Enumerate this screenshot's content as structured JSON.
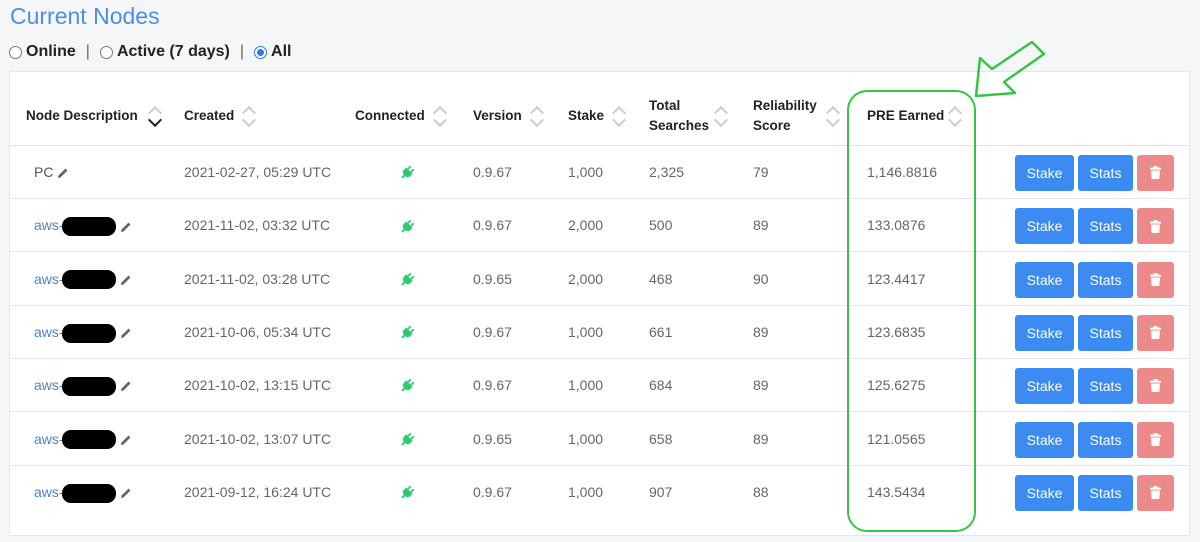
{
  "page": {
    "title": "Current Nodes"
  },
  "filters": [
    {
      "label": "Online",
      "checked": false
    },
    {
      "label": "Active (7 days)",
      "checked": false
    },
    {
      "label": "All",
      "checked": true
    }
  ],
  "filter_separator": "|",
  "table": {
    "headers": {
      "node_description": "Node Description",
      "created": "Created",
      "connected": "Connected",
      "version": "Version",
      "stake": "Stake",
      "total_searches_1": "Total",
      "total_searches_2": "Searches",
      "reliability_1": "Reliability",
      "reliability_2": "Score",
      "pre_earned": "PRE Earned"
    },
    "sort": {
      "column": "Node Description",
      "direction": "desc"
    },
    "rows": [
      {
        "name": "PC",
        "redacted": false,
        "created": "2021-02-27, 05:29 UTC",
        "version": "0.9.67",
        "stake": "1,000",
        "searches": "2,325",
        "reliability": "79",
        "pre_earned": "1,146.8816"
      },
      {
        "name": "aws-",
        "redacted": true,
        "created": "2021-11-02, 03:32 UTC",
        "version": "0.9.67",
        "stake": "2,000",
        "searches": "500",
        "reliability": "89",
        "pre_earned": "133.0876"
      },
      {
        "name": "aws-",
        "redacted": true,
        "created": "2021-11-02, 03:28 UTC",
        "version": "0.9.65",
        "stake": "2,000",
        "searches": "468",
        "reliability": "90",
        "pre_earned": "123.4417"
      },
      {
        "name": "aws-",
        "redacted": true,
        "created": "2021-10-06, 05:34 UTC",
        "version": "0.9.67",
        "stake": "1,000",
        "searches": "661",
        "reliability": "89",
        "pre_earned": "123.6835"
      },
      {
        "name": "aws-",
        "redacted": true,
        "created": "2021-10-02, 13:15 UTC",
        "version": "0.9.67",
        "stake": "1,000",
        "searches": "684",
        "reliability": "89",
        "pre_earned": "125.6275"
      },
      {
        "name": "aws-",
        "redacted": true,
        "created": "2021-10-02, 13:07 UTC",
        "version": "0.9.65",
        "stake": "1,000",
        "searches": "658",
        "reliability": "89",
        "pre_earned": "121.0565"
      },
      {
        "name": "aws-",
        "redacted": true,
        "created": "2021-09-12, 16:24 UTC",
        "version": "0.9.67",
        "stake": "1,000",
        "searches": "907",
        "reliability": "88",
        "pre_earned": "143.5434"
      }
    ],
    "actions": {
      "stake": "Stake",
      "stats": "Stats",
      "delete_icon": "trash-icon"
    },
    "connected_icon": "plug-icon"
  },
  "annotation": {
    "highlight_color": "#37c445",
    "arrow_icon": "arrow-icon"
  },
  "colors": {
    "primary": "#3b8bf2",
    "danger": "#ec8a8a",
    "title": "#4a90e2",
    "connected": "#2ecc71"
  }
}
